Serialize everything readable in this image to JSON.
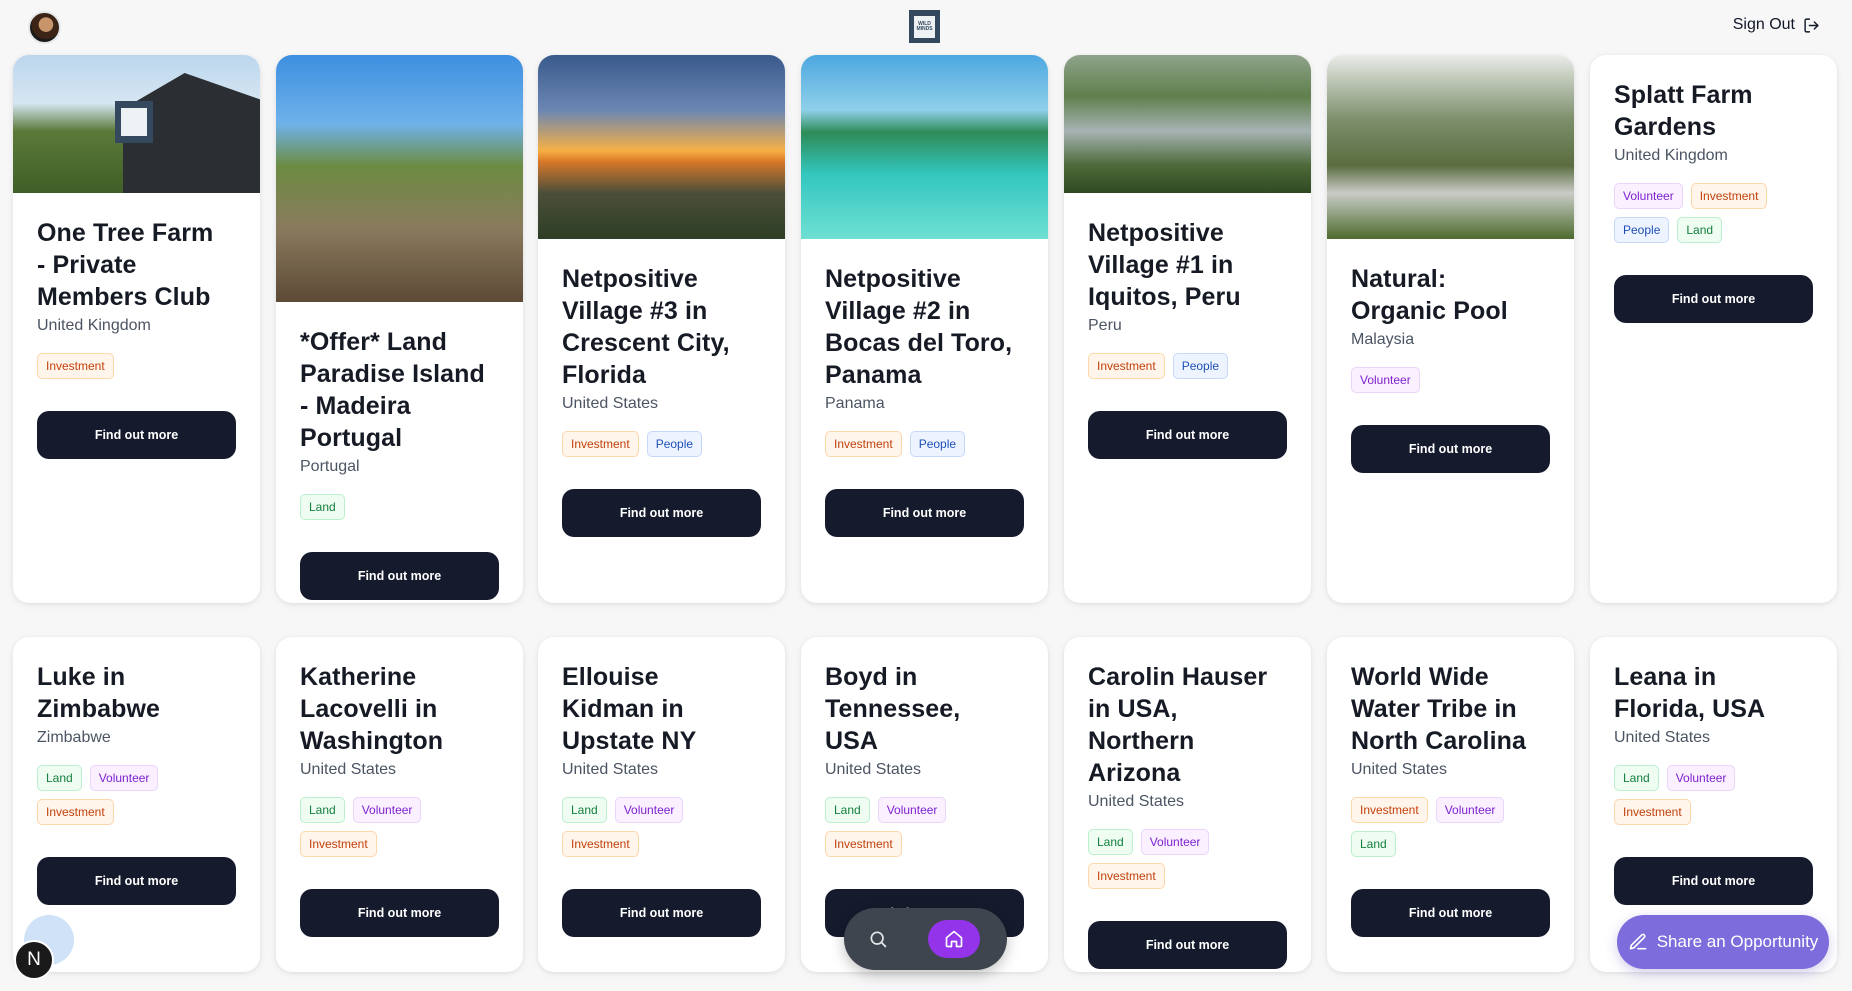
{
  "header": {
    "logo_text": "WILD MINDS",
    "signout_label": "Sign Out"
  },
  "cards": [
    {
      "title": "One Tree Farm - Private Members Club",
      "country": "United Kingdom",
      "tags": [
        "Investment"
      ],
      "button": "Find out more",
      "image": "farm-barn"
    },
    {
      "title": "*Offer* Land Paradise Island - Madeira Portugal",
      "country": "Portugal",
      "tags": [
        "Land"
      ],
      "button": "Find out more",
      "image": "madeira-ruin"
    },
    {
      "title": "Netpositive Village #3 in Crescent City, Florida",
      "country": "United States",
      "tags": [
        "Investment",
        "People"
      ],
      "button": "Find out more",
      "image": "florida-sunset"
    },
    {
      "title": "Netpositive Village #2 in Bocas del Toro, Panama",
      "country": "Panama",
      "tags": [
        "Investment",
        "People"
      ],
      "button": "Find out more",
      "image": "panama-beach"
    },
    {
      "title": "Netpositive Village #1 in Iquitos, Peru",
      "country": "Peru",
      "tags": [
        "Investment",
        "People"
      ],
      "button": "Find out more",
      "image": "amazon-river"
    },
    {
      "title": "Natural: Organic Pool",
      "country": "Malaysia",
      "tags": [
        "Volunteer"
      ],
      "button": "Find out more",
      "image": "jungle-lodge"
    },
    {
      "title": "Splatt Farm Gardens",
      "country": "United Kingdom",
      "tags": [
        "Volunteer",
        "Investment",
        "People",
        "Land"
      ],
      "button": "Find out more",
      "image": null
    },
    {
      "title": "Luke in Zimbabwe",
      "country": "Zimbabwe",
      "tags": [
        "Land",
        "Volunteer",
        "Investment"
      ],
      "button": "Find out more",
      "image": null
    },
    {
      "title": "Katherine Lacovelli in Washington",
      "country": "United States",
      "tags": [
        "Land",
        "Volunteer",
        "Investment"
      ],
      "button": "Find out more",
      "image": null
    },
    {
      "title": "Ellouise Kidman in Upstate NY",
      "country": "United States",
      "tags": [
        "Land",
        "Volunteer",
        "Investment"
      ],
      "button": "Find out more",
      "image": null
    },
    {
      "title": "Boyd in Tennessee, USA",
      "country": "United States",
      "tags": [
        "Land",
        "Volunteer",
        "Investment"
      ],
      "button": "Find out more",
      "image": null
    },
    {
      "title": "Carolin Hauser in USA, Northern Arizona",
      "country": "United States",
      "tags": [
        "Land",
        "Volunteer",
        "Investment"
      ],
      "button": "Find out more",
      "image": null
    },
    {
      "title": "World Wide Water Tribe in North Carolina",
      "country": "United States",
      "tags": [
        "Investment",
        "Volunteer",
        "Land"
      ],
      "button": "Find out more",
      "image": null
    },
    {
      "title": "Leana in Florida, USA",
      "country": "United States",
      "tags": [
        "Land",
        "Volunteer",
        "Investment"
      ],
      "button": "Find out more",
      "image": null
    }
  ],
  "bottom_nav": {
    "items": [
      {
        "icon": "search-icon"
      },
      {
        "icon": "home-icon",
        "active": true
      }
    ]
  },
  "share_button": {
    "label": "Share an Opportunity",
    "icon": "pencil-icon"
  },
  "helper_badge": {
    "letter": "N"
  },
  "colors": {
    "button": "#151a2d",
    "nav_active": "#9333ea",
    "share": "#7c6cdc"
  }
}
